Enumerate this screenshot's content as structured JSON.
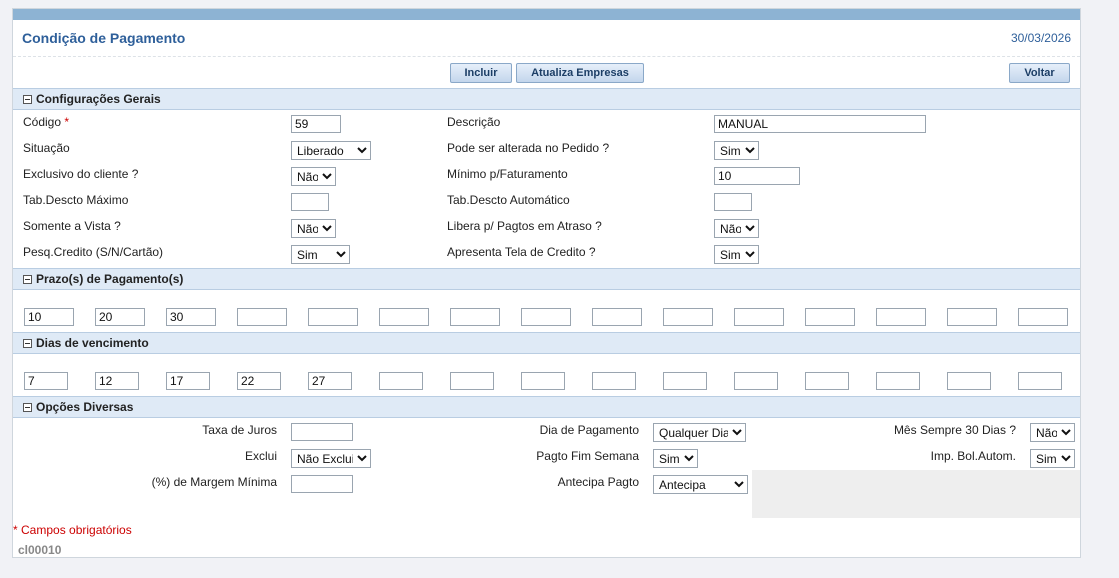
{
  "header": {
    "title": "Condição de Pagamento",
    "date": "30/03/2026"
  },
  "toolbar": {
    "incluir": "Incluir",
    "atualiza": "Atualiza Empresas",
    "voltar": "Voltar"
  },
  "sections": {
    "gerais": "Configurações Gerais",
    "prazos": "Prazo(s) de Pagamento(s)",
    "dias": "Dias de vencimento",
    "opcoes": "Opções Diversas"
  },
  "gerais": {
    "codigo_label": "Código",
    "required_mark": "*",
    "codigo_value": "59",
    "descricao_label": "Descrição",
    "descricao_value": "MANUAL",
    "situacao_label": "Situação",
    "situacao_value": "Liberado",
    "pode_alterar_label": "Pode ser alterada no Pedido ?",
    "pode_alterar_value": "Sim",
    "exclusivo_label": "Exclusivo do cliente ?",
    "exclusivo_value": "Não",
    "minimo_label": "Mínimo p/Faturamento",
    "minimo_value": "10",
    "tab_max_label": "Tab.Descto Máximo",
    "tab_max_value": "",
    "tab_auto_label": "Tab.Descto Automático",
    "tab_auto_value": "",
    "vista_label": "Somente a Vista ?",
    "vista_value": "Não",
    "libera_label": "Libera p/ Pagtos em Atraso ?",
    "libera_value": "Não",
    "pesq_label": "Pesq.Credito (S/N/Cartão)",
    "pesq_value": "Sim",
    "apresenta_label": "Apresenta Tela de Credito ?",
    "apresenta_value": "Sim"
  },
  "prazos": [
    "10",
    "20",
    "30",
    "",
    "",
    "",
    "",
    "",
    "",
    "",
    "",
    "",
    "",
    "",
    ""
  ],
  "dias": [
    "7",
    "12",
    "17",
    "22",
    "27",
    "",
    "",
    "",
    "",
    "",
    "",
    "",
    "",
    "",
    ""
  ],
  "opcoes": {
    "taxa_label": "Taxa de Juros",
    "taxa_value": "",
    "dia_label": "Dia de Pagamento",
    "dia_value": "Qualquer Dia",
    "mes_label": "Mês Sempre 30 Dias ?",
    "mes_value": "Não",
    "exclui_label": "Exclui",
    "exclui_value": "Não Exclui",
    "fim_label": "Pagto Fim Semana",
    "fim_value": "Sim",
    "imp_label": "Imp. Bol.Autom.",
    "imp_value": "Sim",
    "margem_label": "(%) de Margem Mínima",
    "margem_value": "",
    "antecipa_label": "Antecipa Pagto",
    "antecipa_value": "Antecipa"
  },
  "footer": {
    "note": "* Campos obrigatórios",
    "code": "cl00010"
  }
}
